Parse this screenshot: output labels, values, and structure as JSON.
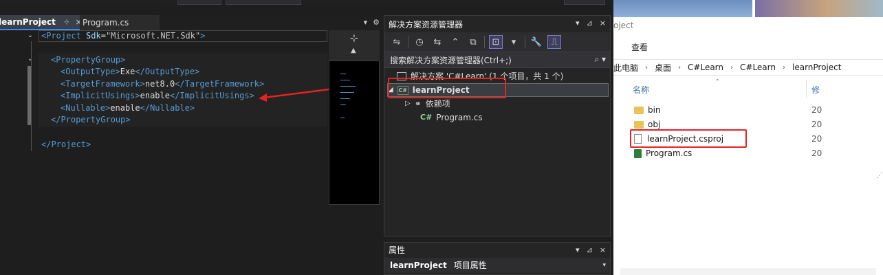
{
  "editor": {
    "tabs": [
      {
        "label": "learnProject",
        "pin": "⊹",
        "close": "×"
      },
      {
        "label": "Program.cs"
      }
    ],
    "code_lines": [
      {
        "indent": 0,
        "open": "<",
        "tag": "Project",
        "attr": " Sdk",
        "eq": "=",
        "str": "\"Microsoft.NET.Sdk\"",
        "close": ">"
      },
      {
        "indent": 0,
        "text": ""
      },
      {
        "indent": 2,
        "open": "<",
        "tag": "PropertyGroup",
        "close": ">"
      },
      {
        "indent": 4,
        "open": "<",
        "tag": "OutputType",
        "close": ">",
        "value": "Exe",
        "endtag": "</OutputType>"
      },
      {
        "indent": 4,
        "open": "<",
        "tag": "TargetFramework",
        "close": ">",
        "value": "net8.0",
        "endtag": "</TargetFramework>"
      },
      {
        "indent": 4,
        "open": "<",
        "tag": "ImplicitUsings",
        "close": ">",
        "value": "enable",
        "endtag": "</ImplicitUsings>"
      },
      {
        "indent": 4,
        "open": "<",
        "tag": "Nullable",
        "close": ">",
        "value": "enable",
        "endtag": "</Nullable>"
      },
      {
        "indent": 2,
        "endtag": "</PropertyGroup>"
      },
      {
        "indent": 0,
        "text": ""
      },
      {
        "indent": 0,
        "endtag": "</Project>"
      }
    ]
  },
  "solution_explorer": {
    "title": "解决方案资源管理器",
    "title_buttons": [
      "▾",
      "⊿",
      "×"
    ],
    "search_placeholder": "搜索解决方案资源管理器(Ctrl+;)",
    "solution_label": "解决方案 'C#Learn' (1 个项目，共 1 个)",
    "project_label": "learnProject",
    "project_icon_text": "C#",
    "dependencies_label": "依赖项",
    "program_label": "Program.cs",
    "cs_icon_text": "C#"
  },
  "properties": {
    "title": "属性",
    "object_name": "learnProject",
    "object_kind": "项目属性"
  },
  "file_explorer": {
    "title": "oject",
    "ribbon_view": "查看",
    "breadcrumb": [
      "此电脑",
      "桌面",
      "C#Learn",
      "C#Learn",
      "learnProject"
    ],
    "col_name": "名称",
    "col_modified": "修",
    "files": [
      {
        "name": "bin",
        "type": "folder",
        "date": "20"
      },
      {
        "name": "obj",
        "type": "folder",
        "date": "20"
      },
      {
        "name": "learnProject.csproj",
        "type": "file",
        "date": "20"
      },
      {
        "name": "Program.cs",
        "type": "cs",
        "date": "20"
      }
    ]
  },
  "colors": {
    "annotation_red": "#e62222",
    "xml_tag_blue": "#569cd6",
    "csharp_green": "#8bd39a"
  }
}
